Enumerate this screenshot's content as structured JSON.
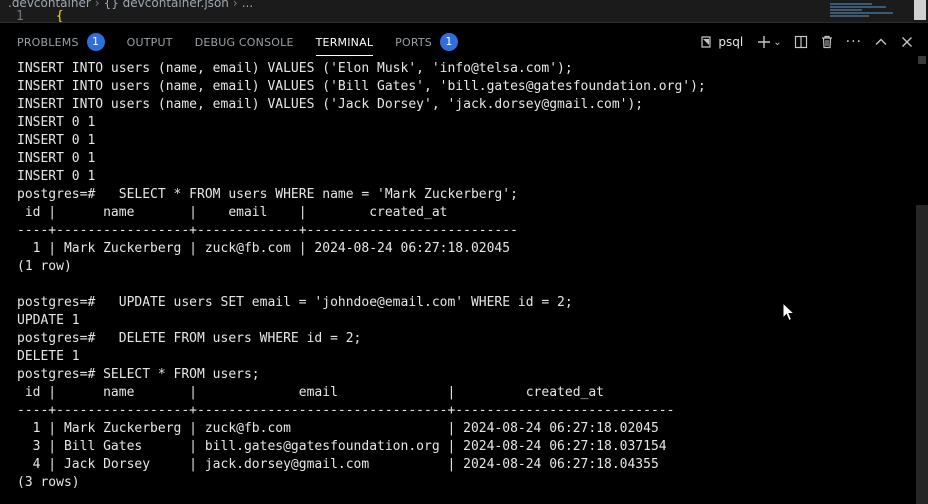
{
  "editor": {
    "breadcrumb": [
      ".devcontainer",
      "{} devcontainer.json",
      "..."
    ],
    "line_number": "1",
    "line_text": "{"
  },
  "panel": {
    "tabs": [
      {
        "label": "PROBLEMS",
        "badge": "1"
      },
      {
        "label": "OUTPUT"
      },
      {
        "label": "DEBUG CONSOLE"
      },
      {
        "label": "TERMINAL",
        "active": true
      },
      {
        "label": "PORTS",
        "badge": "1"
      }
    ],
    "terminal_name": "psql",
    "icons": [
      "terminal-icon",
      "plus-icon",
      "chevron-down-icon",
      "split-terminal-icon",
      "trash-icon",
      "more-icon",
      "maximize-icon",
      "close-icon"
    ]
  },
  "terminal": {
    "lines": [
      "INSERT INTO users (name, email) VALUES ('Elon Musk', 'info@telsa.com');",
      "INSERT INTO users (name, email) VALUES ('Bill Gates', 'bill.gates@gatesfoundation.org');",
      "INSERT INTO users (name, email) VALUES ('Jack Dorsey', 'jack.dorsey@gmail.com');",
      "INSERT 0 1",
      "INSERT 0 1",
      "INSERT 0 1",
      "INSERT 0 1",
      "postgres=#   SELECT * FROM users WHERE name = 'Mark Zuckerberg';",
      " id |      name       |    email    |        created_at",
      "----+-----------------+-------------+---------------------------",
      "  1 | Mark Zuckerberg | zuck@fb.com | 2024-08-24 06:27:18.02045",
      "(1 row)",
      "",
      "postgres=#   UPDATE users SET email = 'johndoe@email.com' WHERE id = 2;",
      "UPDATE 1",
      "postgres=#   DELETE FROM users WHERE id = 2;",
      "DELETE 1",
      "postgres=# SELECT * FROM users;",
      " id |      name       |             email              |         created_at",
      "----+-----------------+--------------------------------+----------------------------",
      "  1 | Mark Zuckerberg | zuck@fb.com                    | 2024-08-24 06:27:18.02045",
      "  3 | Bill Gates      | bill.gates@gatesfoundation.org | 2024-08-24 06:27:18.037154",
      "  4 | Jack Dorsey     | jack.dorsey@gmail.com          | 2024-08-24 06:27:18.04355",
      "(3 rows)"
    ]
  },
  "colors": {
    "background": "#000000",
    "badge": "#2f6fdb",
    "text": "#e6e6e6",
    "inactive_tab": "#9aa0a6"
  }
}
